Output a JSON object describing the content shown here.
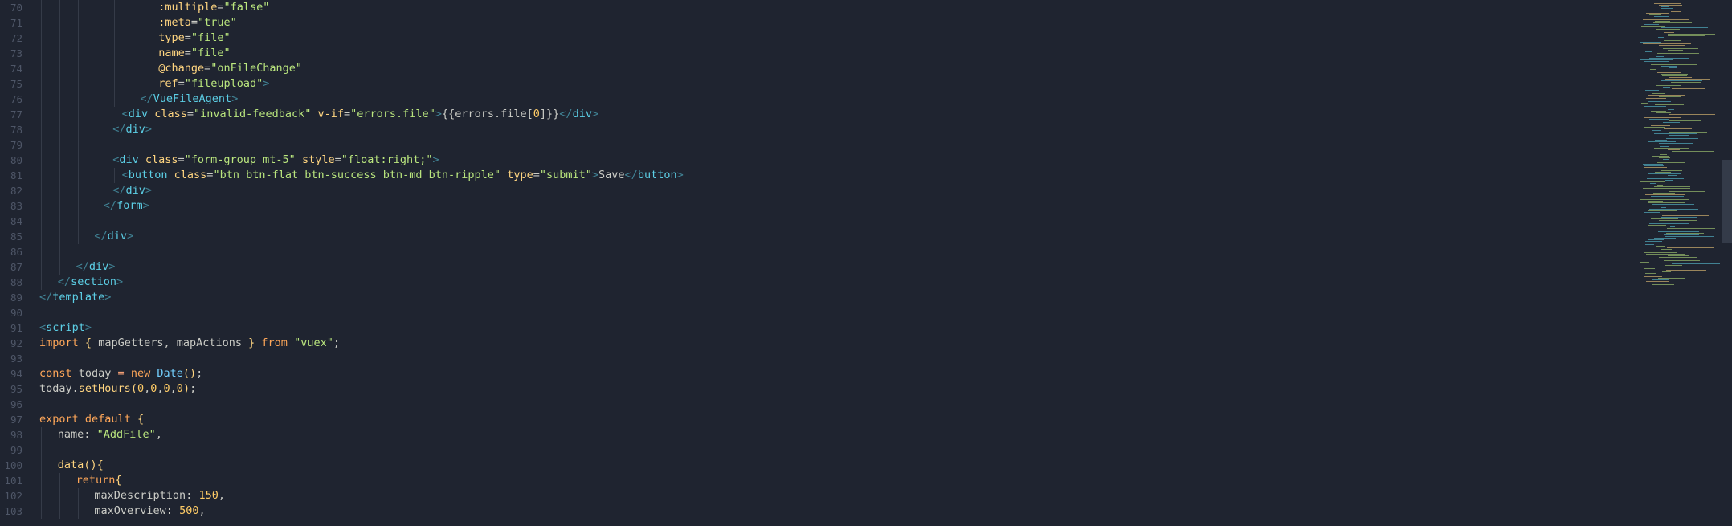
{
  "editor": {
    "lines": [
      {
        "n": "70",
        "indent": 13,
        "g": [
          1,
          2,
          3,
          4,
          5,
          6
        ],
        "tokens": [
          [
            "attr",
            ":multiple"
          ],
          [
            "id",
            "="
          ],
          [
            "str",
            "\"false\""
          ]
        ]
      },
      {
        "n": "71",
        "indent": 13,
        "g": [
          1,
          2,
          3,
          4,
          5,
          6
        ],
        "tokens": [
          [
            "attr",
            ":meta"
          ],
          [
            "id",
            "="
          ],
          [
            "str",
            "\"true\""
          ]
        ]
      },
      {
        "n": "72",
        "indent": 13,
        "g": [
          1,
          2,
          3,
          4,
          5,
          6
        ],
        "tokens": [
          [
            "attr",
            "type"
          ],
          [
            "id",
            "="
          ],
          [
            "str",
            "\"file\""
          ]
        ]
      },
      {
        "n": "73",
        "indent": 13,
        "g": [
          1,
          2,
          3,
          4,
          5,
          6
        ],
        "tokens": [
          [
            "attr",
            "name"
          ],
          [
            "id",
            "="
          ],
          [
            "str",
            "\"file\""
          ]
        ]
      },
      {
        "n": "74",
        "indent": 13,
        "g": [
          1,
          2,
          3,
          4,
          5,
          6
        ],
        "tokens": [
          [
            "attr",
            "@change"
          ],
          [
            "id",
            "="
          ],
          [
            "str",
            "\"onFileChange\""
          ]
        ]
      },
      {
        "n": "75",
        "indent": 13,
        "g": [
          1,
          2,
          3,
          4,
          5,
          6
        ],
        "tokens": [
          [
            "attr",
            "ref"
          ],
          [
            "id",
            "="
          ],
          [
            "str",
            "\"fileupload\""
          ],
          [
            "punc",
            ">"
          ]
        ]
      },
      {
        "n": "76",
        "indent": 11,
        "g": [
          1,
          2,
          3,
          4,
          5
        ],
        "tokens": [
          [
            "punc",
            "</"
          ],
          [
            "tag",
            "VueFileAgent"
          ],
          [
            "punc",
            ">"
          ]
        ]
      },
      {
        "n": "77",
        "indent": 9,
        "g": [
          1,
          2,
          3,
          4
        ],
        "tokens": [
          [
            "punc",
            "<"
          ],
          [
            "tag",
            "div"
          ],
          [
            "id",
            " "
          ],
          [
            "attr",
            "class"
          ],
          [
            "id",
            "="
          ],
          [
            "str",
            "\"invalid-feedback\""
          ],
          [
            "id",
            " "
          ],
          [
            "attr",
            "v-if"
          ],
          [
            "id",
            "="
          ],
          [
            "str",
            "\"errors.file\""
          ],
          [
            "punc",
            ">"
          ],
          [
            "id",
            "{{errors.file["
          ],
          [
            "num",
            "0"
          ],
          [
            "id",
            "]}}"
          ],
          [
            "punc",
            "</"
          ],
          [
            "tag",
            "div"
          ],
          [
            "punc",
            ">"
          ]
        ]
      },
      {
        "n": "78",
        "indent": 8,
        "g": [
          1,
          2,
          3,
          4
        ],
        "tokens": [
          [
            "punc",
            "</"
          ],
          [
            "tag",
            "div"
          ],
          [
            "punc",
            ">"
          ]
        ]
      },
      {
        "n": "79",
        "indent": 0,
        "g": [
          1,
          2,
          3,
          4
        ],
        "tokens": []
      },
      {
        "n": "80",
        "indent": 8,
        "g": [
          1,
          2,
          3,
          4
        ],
        "tokens": [
          [
            "punc",
            "<"
          ],
          [
            "tag",
            "div"
          ],
          [
            "id",
            " "
          ],
          [
            "attr",
            "class"
          ],
          [
            "id",
            "="
          ],
          [
            "str",
            "\"form-group mt-5\""
          ],
          [
            "id",
            " "
          ],
          [
            "attr",
            "style"
          ],
          [
            "id",
            "="
          ],
          [
            "str",
            "\"float:right;\""
          ],
          [
            "punc",
            ">"
          ]
        ]
      },
      {
        "n": "81",
        "indent": 9,
        "g": [
          1,
          2,
          3,
          4,
          5
        ],
        "tokens": [
          [
            "punc",
            "<"
          ],
          [
            "tag",
            "button"
          ],
          [
            "id",
            " "
          ],
          [
            "attr",
            "class"
          ],
          [
            "id",
            "="
          ],
          [
            "str",
            "\"btn btn-flat btn-success btn-md btn-ripple\""
          ],
          [
            "id",
            " "
          ],
          [
            "attr",
            "type"
          ],
          [
            "id",
            "="
          ],
          [
            "str",
            "\"submit\""
          ],
          [
            "punc",
            ">"
          ],
          [
            "id",
            "Save"
          ],
          [
            "punc",
            "</"
          ],
          [
            "tag",
            "button"
          ],
          [
            "punc",
            ">"
          ]
        ]
      },
      {
        "n": "82",
        "indent": 8,
        "g": [
          1,
          2,
          3,
          4
        ],
        "tokens": [
          [
            "punc",
            "</"
          ],
          [
            "tag",
            "div"
          ],
          [
            "punc",
            ">"
          ]
        ]
      },
      {
        "n": "83",
        "indent": 7,
        "g": [
          1,
          2,
          3
        ],
        "tokens": [
          [
            "punc",
            "</"
          ],
          [
            "tag",
            "form"
          ],
          [
            "punc",
            ">"
          ]
        ]
      },
      {
        "n": "84",
        "indent": 0,
        "g": [
          1,
          2,
          3
        ],
        "tokens": []
      },
      {
        "n": "85",
        "indent": 6,
        "g": [
          1,
          2,
          3
        ],
        "tokens": [
          [
            "punc",
            "</"
          ],
          [
            "tag",
            "div"
          ],
          [
            "punc",
            ">"
          ]
        ]
      },
      {
        "n": "86",
        "indent": 0,
        "g": [
          1,
          2
        ],
        "tokens": []
      },
      {
        "n": "87",
        "indent": 4,
        "g": [
          1,
          2
        ],
        "tokens": [
          [
            "punc",
            "</"
          ],
          [
            "tag",
            "div"
          ],
          [
            "punc",
            ">"
          ]
        ]
      },
      {
        "n": "88",
        "indent": 2,
        "g": [
          1
        ],
        "tokens": [
          [
            "punc",
            "</"
          ],
          [
            "tag",
            "section"
          ],
          [
            "punc",
            ">"
          ]
        ]
      },
      {
        "n": "89",
        "indent": 0,
        "g": [],
        "tokens": [
          [
            "punc",
            "</"
          ],
          [
            "tag",
            "template"
          ],
          [
            "punc",
            ">"
          ]
        ]
      },
      {
        "n": "90",
        "indent": 0,
        "g": [],
        "tokens": []
      },
      {
        "n": "91",
        "indent": 0,
        "g": [],
        "tokens": [
          [
            "punc",
            "<"
          ],
          [
            "tag",
            "script"
          ],
          [
            "punc",
            ">"
          ]
        ]
      },
      {
        "n": "92",
        "indent": 0,
        "g": [],
        "tokens": [
          [
            "kw",
            "import"
          ],
          [
            "id",
            " "
          ],
          [
            "fn",
            "{"
          ],
          [
            "id",
            " mapGetters, mapActions "
          ],
          [
            "fn",
            "}"
          ],
          [
            "id",
            " "
          ],
          [
            "kw",
            "from"
          ],
          [
            "id",
            " "
          ],
          [
            "str",
            "\"vuex\""
          ],
          [
            "id",
            ";"
          ]
        ]
      },
      {
        "n": "93",
        "indent": 0,
        "g": [],
        "tokens": []
      },
      {
        "n": "94",
        "indent": 0,
        "g": [],
        "tokens": [
          [
            "kw",
            "const"
          ],
          [
            "id",
            " today "
          ],
          [
            "op",
            "="
          ],
          [
            "id",
            " "
          ],
          [
            "kw",
            "new"
          ],
          [
            "id",
            " "
          ],
          [
            "cls",
            "Date"
          ],
          [
            "fn",
            "()"
          ],
          [
            "id",
            ";"
          ]
        ]
      },
      {
        "n": "95",
        "indent": 0,
        "g": [],
        "tokens": [
          [
            "id",
            "today."
          ],
          [
            "fn",
            "setHours"
          ],
          [
            "fn",
            "("
          ],
          [
            "num",
            "0"
          ],
          [
            "id",
            ","
          ],
          [
            "num",
            "0"
          ],
          [
            "id",
            ","
          ],
          [
            "num",
            "0"
          ],
          [
            "id",
            ","
          ],
          [
            "num",
            "0"
          ],
          [
            "fn",
            ")"
          ],
          [
            "id",
            ";"
          ]
        ]
      },
      {
        "n": "96",
        "indent": 0,
        "g": [],
        "tokens": []
      },
      {
        "n": "97",
        "indent": 0,
        "g": [],
        "tokens": [
          [
            "kw",
            "export"
          ],
          [
            "id",
            " "
          ],
          [
            "kw",
            "default"
          ],
          [
            "id",
            " "
          ],
          [
            "fn",
            "{"
          ]
        ]
      },
      {
        "n": "98",
        "indent": 2,
        "g": [
          1
        ],
        "tokens": [
          [
            "prop",
            "name"
          ],
          [
            "id",
            ": "
          ],
          [
            "str",
            "\"AddFile\""
          ],
          [
            "id",
            ","
          ]
        ]
      },
      {
        "n": "99",
        "indent": 0,
        "g": [
          1
        ],
        "tokens": []
      },
      {
        "n": "100",
        "indent": 2,
        "g": [
          1
        ],
        "tokens": [
          [
            "fn",
            "data"
          ],
          [
            "fn",
            "(){"
          ]
        ]
      },
      {
        "n": "101",
        "indent": 4,
        "g": [
          1,
          2
        ],
        "tokens": [
          [
            "kw",
            "return"
          ],
          [
            "fn",
            "{"
          ]
        ]
      },
      {
        "n": "102",
        "indent": 6,
        "g": [
          1,
          2,
          3
        ],
        "tokens": [
          [
            "prop",
            "maxDescription"
          ],
          [
            "id",
            ": "
          ],
          [
            "num",
            "150"
          ],
          [
            "id",
            ","
          ]
        ]
      },
      {
        "n": "103",
        "indent": 6,
        "g": [
          1,
          2,
          3
        ],
        "tokens": [
          [
            "prop",
            "maxOverview"
          ],
          [
            "id",
            ": "
          ],
          [
            "num",
            "500"
          ],
          [
            "id",
            ","
          ]
        ]
      }
    ]
  },
  "colors": {
    "background": "#1f2430",
    "tag": "#5ccfe6",
    "attr": "#ffd580",
    "string": "#bae67e",
    "keyword": "#ffa759",
    "number": "#ffcc66",
    "class": "#73d0ff",
    "text": "#cbccc6",
    "gutter": "#4e5667"
  },
  "minimap": {
    "icon": "minimap-preview"
  },
  "scrollbar": {
    "icon": "vertical-scrollbar"
  }
}
